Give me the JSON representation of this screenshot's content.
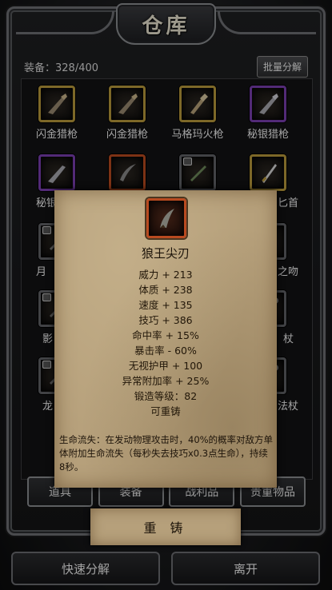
{
  "title": "仓库",
  "equip_count": "装备：328/400",
  "batch_button": "批量分解",
  "items": [
    {
      "name": "闪金猎枪",
      "border": "gold",
      "icon": "gun-icon"
    },
    {
      "name": "闪金猎枪",
      "border": "gold",
      "icon": "gun-icon"
    },
    {
      "name": "马格玛火枪",
      "border": "gold",
      "icon": "gun-icon"
    },
    {
      "name": "秘银猎枪",
      "border": "purple",
      "icon": "gun-icon"
    },
    {
      "name": "秘银",
      "border": "purple",
      "icon": "gun-icon"
    },
    {
      "name": "",
      "border": "orange",
      "icon": "blade-icon"
    },
    {
      "name": "",
      "border": "grey",
      "icon": "blade-icon"
    },
    {
      "name": "匕首",
      "border": "gold",
      "icon": "dagger-icon"
    },
    {
      "name": "月",
      "border": "grey",
      "icon": "blade-icon"
    },
    {
      "name": "之吻",
      "border": "grey",
      "icon": "blade-icon"
    },
    {
      "name": "影",
      "border": "grey",
      "icon": "blade-icon"
    },
    {
      "name": "杖",
      "border": "grey",
      "icon": "staff-icon"
    },
    {
      "name": "龙",
      "border": "grey",
      "icon": "blade-icon"
    },
    {
      "name": "法杖",
      "border": "grey",
      "icon": "staff-icon"
    }
  ],
  "tabs": [
    "道具",
    "装备",
    "战利品",
    "贵重物品"
  ],
  "tooltip": {
    "item_name": "狼王尖刃",
    "stats": [
      "威力 + 213",
      "体质 + 238",
      "速度 + 135",
      "技巧 + 386",
      "命中率 + 15%",
      "暴击率 - 60%",
      "无视护甲 + 100",
      "异常附加率 + 25%",
      "锻造等级：82",
      "可重铸"
    ],
    "description": "生命流失：在发动物理攻击时，40%的概率对敌方单体附加生命流失（每秒失去技巧x0.3点生命），持续8秒。"
  },
  "reforge_button": "重 铸",
  "quick_decompose_button": "快速分解",
  "leave_button": "离开",
  "colors": {
    "gold_border": "#b89a3c",
    "purple_border": "#7a3fb0",
    "orange_border": "#b84a20",
    "parchment": "#b6a07b"
  }
}
